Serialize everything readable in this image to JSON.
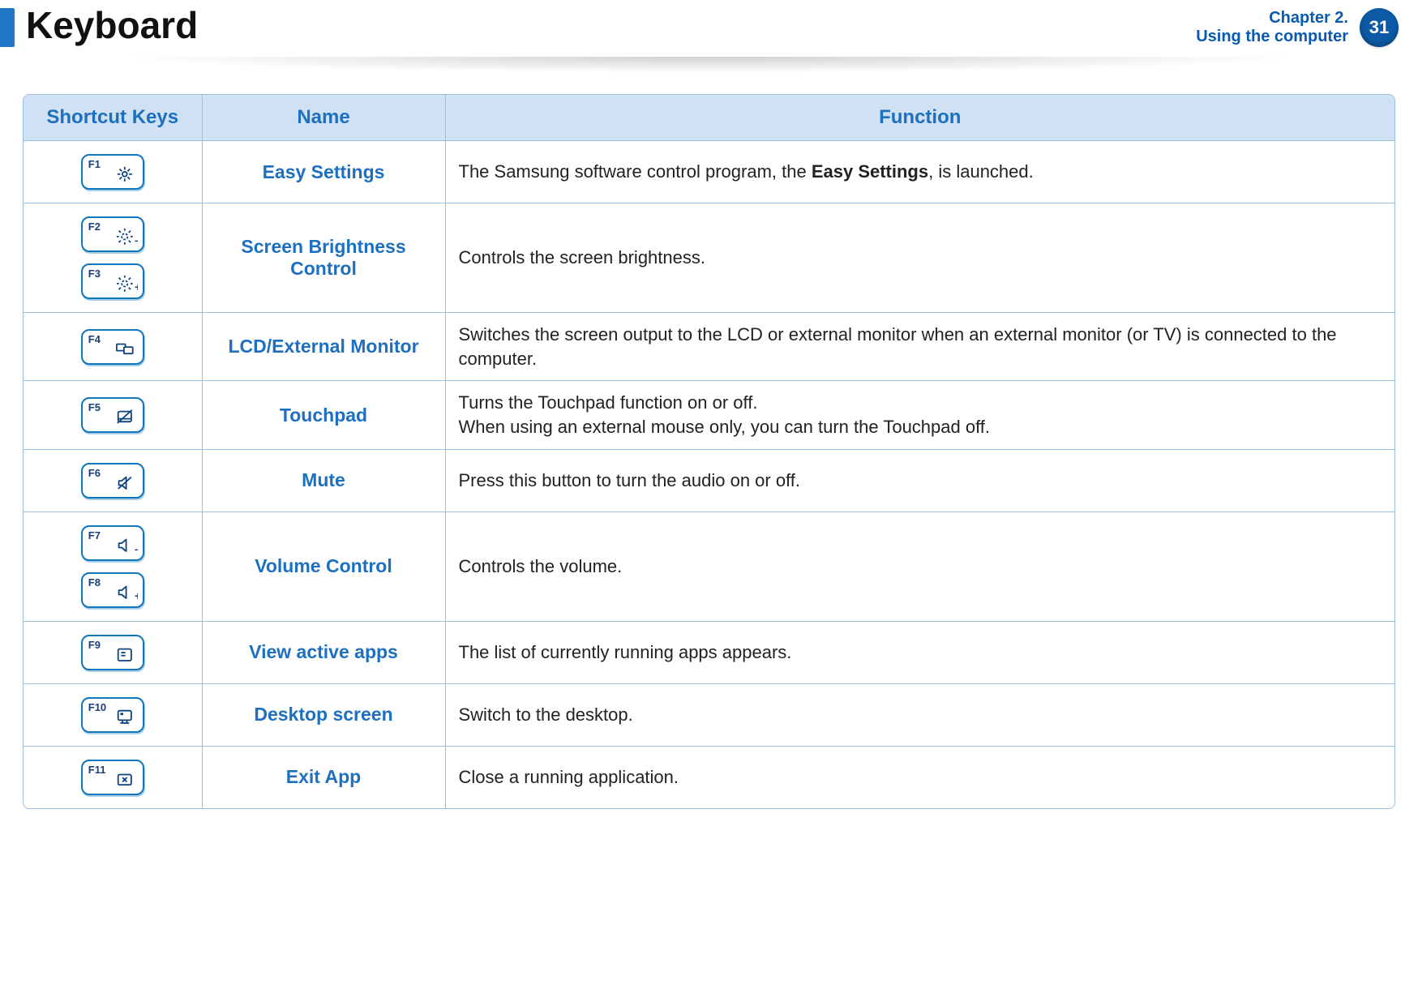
{
  "header": {
    "title": "Keyboard",
    "chapter_line1": "Chapter 2.",
    "chapter_line2": "Using the computer",
    "page_number": "31"
  },
  "table": {
    "headers": {
      "shortcut": "Shortcut Keys",
      "name": "Name",
      "function": "Function"
    },
    "rows": [
      {
        "keys": [
          {
            "label": "F1",
            "icon": "gear-icon"
          }
        ],
        "name": "Easy Settings",
        "function_html": "The Samsung software control program, the <b>Easy Settings</b>, is launched."
      },
      {
        "keys": [
          {
            "label": "F2",
            "icon": "brightness-down-icon"
          },
          {
            "label": "F3",
            "icon": "brightness-up-icon"
          }
        ],
        "name": "Screen Brightness Control",
        "function_html": "Controls the screen brightness."
      },
      {
        "keys": [
          {
            "label": "F4",
            "icon": "display-switch-icon"
          }
        ],
        "name": "LCD/External Monitor",
        "function_html": "Switches the screen output to the LCD or external monitor when an external monitor (or TV) is connected to the computer."
      },
      {
        "keys": [
          {
            "label": "F5",
            "icon": "touchpad-off-icon"
          }
        ],
        "name": "Touchpad",
        "function_html": "Turns the Touchpad function on or off.<br>When using an external mouse only, you can turn the Touchpad off."
      },
      {
        "keys": [
          {
            "label": "F6",
            "icon": "mute-icon"
          }
        ],
        "name": "Mute",
        "function_html": "Press this button to turn the audio on or off."
      },
      {
        "keys": [
          {
            "label": "F7",
            "icon": "volume-down-icon"
          },
          {
            "label": "F8",
            "icon": "volume-up-icon"
          }
        ],
        "name": "Volume Control",
        "function_html": "Controls the volume."
      },
      {
        "keys": [
          {
            "label": "F9",
            "icon": "apps-list-icon"
          }
        ],
        "name": "View active apps",
        "function_html": "The list of currently running apps appears."
      },
      {
        "keys": [
          {
            "label": "F10",
            "icon": "desktop-icon"
          }
        ],
        "name": "Desktop screen",
        "function_html": "Switch to the desktop."
      },
      {
        "keys": [
          {
            "label": "F11",
            "icon": "close-app-icon"
          }
        ],
        "name": "Exit App",
        "function_html": "Close a running application."
      }
    ]
  }
}
